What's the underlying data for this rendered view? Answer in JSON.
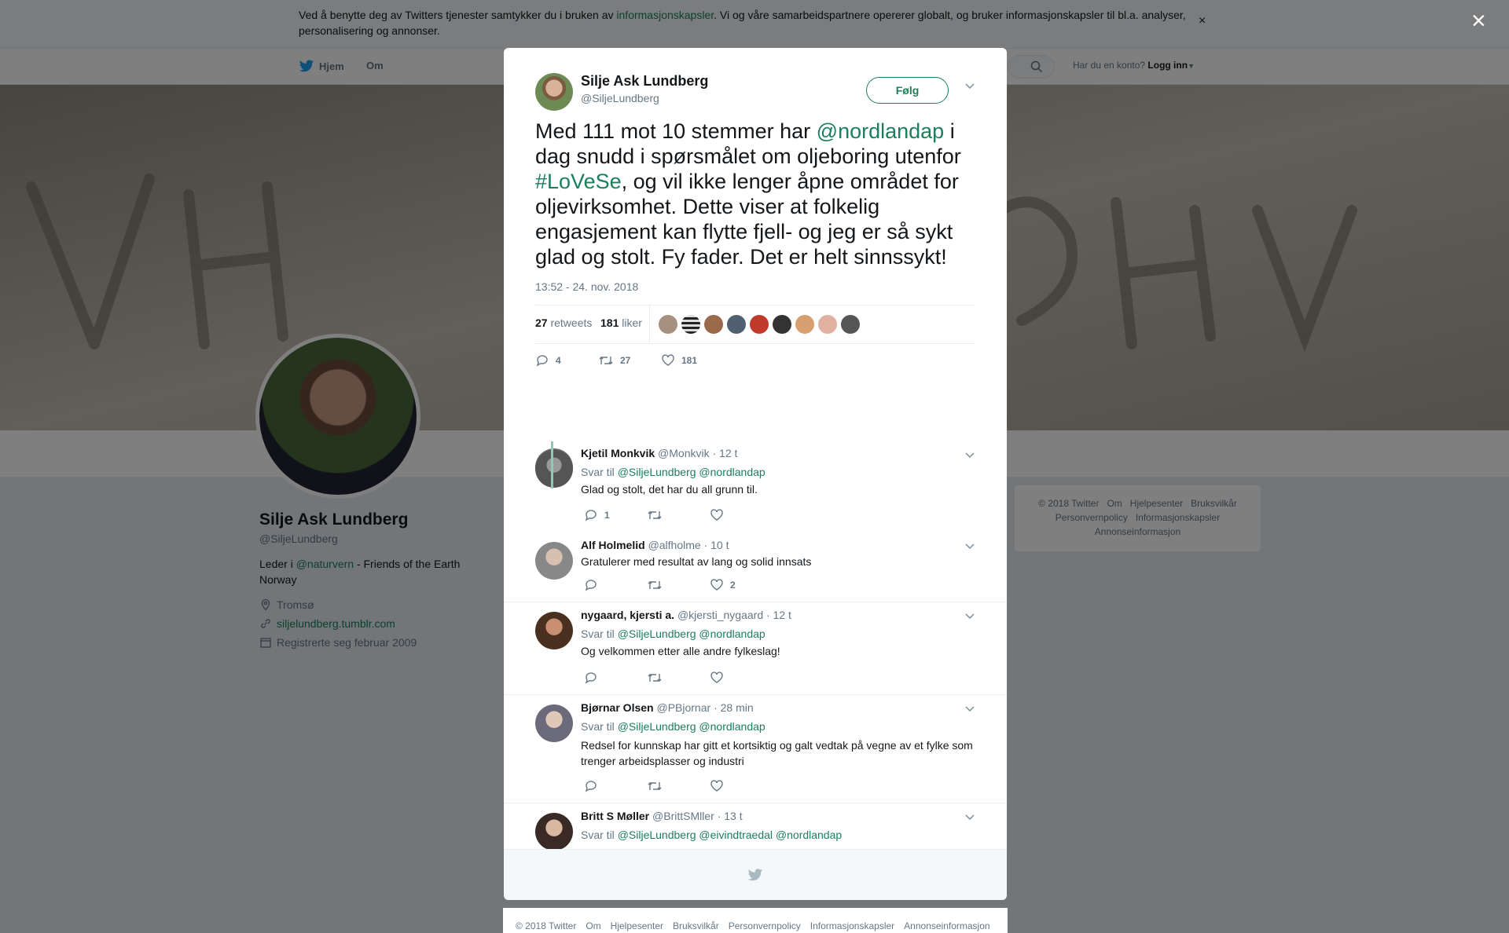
{
  "cookie": {
    "text_before": "Ved å benytte deg av Twitters tjenester samtykker du i bruken av ",
    "link": "informasjonskapsler",
    "text_after": ". Vi og våre samarbeidspartnere opererer globalt, og bruker informasjonskapsler til bl.a. analyser, personalisering og annonser.",
    "close": "×"
  },
  "nav": {
    "home": "Hjem",
    "about": "Om",
    "account_prompt": "Har du en konto?",
    "login": "Logg inn"
  },
  "profile": {
    "name": "Silje Ask Lundberg",
    "handle": "@SiljeLundberg",
    "bio_prefix": "Leder i ",
    "bio_link": "@naturvern",
    "bio_suffix": " - Friends of the Earth Norway",
    "location": "Tromsø",
    "website": "siljelundberg.tumblr.com",
    "joined": "Registrerte seg februar 2009"
  },
  "side_footer": [
    "© 2018 Twitter",
    "Om",
    "Hjelpesenter",
    "Bruksvilkår",
    "Personvernpolicy",
    "Informasjonskapsler",
    "Annonseinformasjon"
  ],
  "modal_close": "×",
  "tweet": {
    "name": "Silje Ask Lundberg",
    "handle": "@SiljeLundberg",
    "follow": "Følg",
    "text_1": "Med 111 mot 10 stemmer har ",
    "mention": "@nordlandap",
    "text_2": " i dag snudd i spørsmålet om oljeboring utenfor ",
    "hashtag": "#LoVeSe",
    "text_3": ", og vil ikke lenger åpne området for oljevirksomhet. Dette viser at folkelig engasjement kan flytte fjell- og jeg er så sykt glad og stolt. Fy fader. Det er helt sinnssykt!",
    "time": "13:52 - 24. nov. 2018",
    "retweets_count": "27",
    "retweets_label": "retweets",
    "likes_count": "181",
    "likes_label": "liker",
    "action_replies": "4",
    "action_retweets": "27",
    "action_likes": "181"
  },
  "replies": [
    {
      "name": "Kjetil Monkvik",
      "handle": "@Monkvik",
      "time": "· 12 t",
      "reply_to_label": "Svar til",
      "reply_to": "@SiljeLundberg @nordlandap",
      "text": "Glad og stolt, det har du all grunn til.",
      "replies": "1",
      "retweets": "",
      "likes": ""
    },
    {
      "name": "Alf Holmelid",
      "handle": "@alfholme",
      "time": "· 10 t",
      "reply_to_label": "",
      "reply_to": "",
      "text": "Gratulerer med resultat av lang og solid innsats",
      "replies": "",
      "retweets": "",
      "likes": "2"
    },
    {
      "name": "nygaard, kjersti a.",
      "handle": "@kjersti_nygaard",
      "time": "· 12 t",
      "reply_to_label": "Svar til",
      "reply_to": "@SiljeLundberg @nordlandap",
      "text": "Og velkommen etter alle andre fylkeslag!",
      "replies": "",
      "retweets": "",
      "likes": ""
    },
    {
      "name": "Bjørnar Olsen",
      "handle": "@PBjornar",
      "time": "· 28 min",
      "reply_to_label": "Svar til",
      "reply_to": "@SiljeLundberg @nordlandap",
      "text": "Redsel for kunnskap har gitt et kortsiktig og galt vedtak på vegne av et fylke som trenger arbeidsplasser og industri",
      "replies": "",
      "retweets": "",
      "likes": ""
    },
    {
      "name": "Britt S Møller",
      "handle": "@BrittSMller",
      "time": "· 13 t",
      "reply_to_label": "Svar til",
      "reply_to": "@SiljeLundberg @eivindtraedal @nordlandap",
      "text": "👏🏻👏🏻💪🏻",
      "replies": "",
      "retweets": "",
      "likes": ""
    }
  ],
  "modal_footer": [
    "© 2018 Twitter",
    "Om",
    "Hjelpesenter",
    "Bruksvilkår",
    "Personvernpolicy",
    "Informasjonskapsler",
    "Annonseinformasjon"
  ],
  "colors": {
    "accent": "#1b7f5a",
    "overlay": "rgba(0,0,0,0.5)",
    "muted": "#657786"
  },
  "icons": [
    "twitter-bird-icon",
    "search-icon",
    "location-icon",
    "link-icon",
    "calendar-icon",
    "reply-icon",
    "retweet-icon",
    "heart-icon",
    "chevron-down-icon",
    "close-icon"
  ]
}
